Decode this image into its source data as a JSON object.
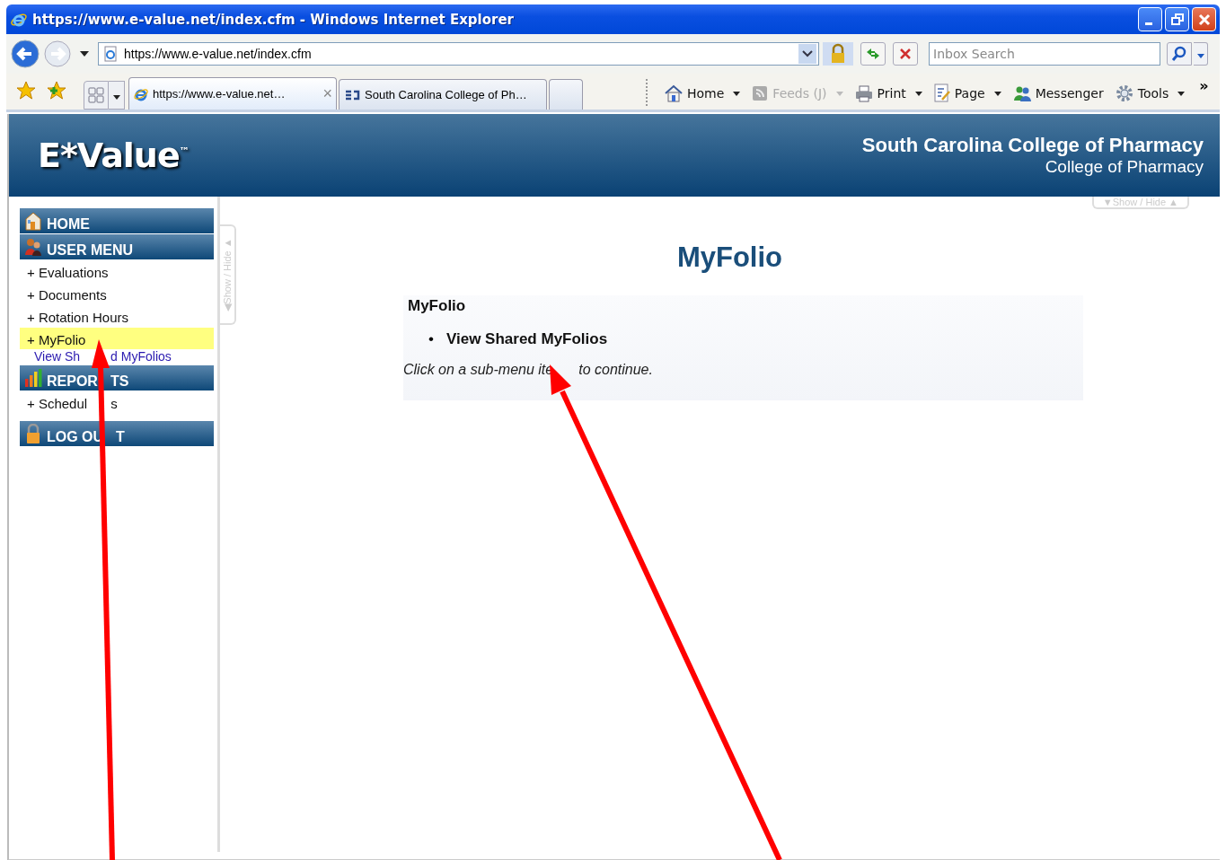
{
  "window": {
    "title": "https://www.e-value.net/index.cfm - Windows Internet Explorer"
  },
  "address": {
    "url": "https://www.e-value.net/index.cfm"
  },
  "search": {
    "placeholder": "Inbox Search"
  },
  "tabs": [
    {
      "label": "https://www.e-value.net…",
      "selected": true,
      "close": "×"
    },
    {
      "label": "South Carolina College of Ph…",
      "selected": false
    },
    {
      "selected": false,
      "kind": "new"
    }
  ],
  "command_bar": {
    "items": [
      {
        "label": "Home",
        "dropdown": true,
        "disabled": false
      },
      {
        "label": "Feeds (J)",
        "dropdown": true,
        "disabled": true
      },
      {
        "label": "Print",
        "dropdown": true,
        "disabled": false
      },
      {
        "label": "Page",
        "dropdown": true,
        "disabled": false
      },
      {
        "label": "Messenger",
        "dropdown": false,
        "disabled": false
      },
      {
        "label": "Tools",
        "dropdown": true,
        "disabled": false
      }
    ],
    "overflow": "»"
  },
  "header": {
    "logo": "E*Value",
    "logo_mark": "™",
    "institution": "South Carolina College of Pharmacy",
    "subtitle": "College of Pharmacy",
    "show_hide": "▼Show / Hide ▲"
  },
  "sidebar": {
    "show_hide": "◀Show / Hide ▲",
    "items": [
      {
        "kind": "header",
        "label": "HOME"
      },
      {
        "kind": "header",
        "label": "USER MENU"
      },
      {
        "kind": "item",
        "label": "+ Evaluations",
        "selected": false
      },
      {
        "kind": "item",
        "label": "+ Documents",
        "selected": false
      },
      {
        "kind": "item",
        "label": "+ Rotation Hours",
        "selected": false
      },
      {
        "kind": "item",
        "label": "+ MyFolio",
        "selected": true
      },
      {
        "kind": "subitem",
        "parts": [
          "View Sh",
          "d MyFolios"
        ]
      },
      {
        "kind": "header",
        "parts": [
          "REPOR",
          "TS"
        ]
      },
      {
        "kind": "item",
        "parts": [
          "+ Schedul",
          "s"
        ],
        "selected": false
      },
      {
        "kind": "header",
        "parts": [
          "LOG OU",
          "T"
        ]
      }
    ]
  },
  "main": {
    "title": "MyFolio",
    "section": "MyFolio",
    "bullet": "•",
    "links": [
      "View Shared MyFolios"
    ],
    "note_parts": [
      "Click on a sub-menu ite",
      "to continue."
    ]
  }
}
